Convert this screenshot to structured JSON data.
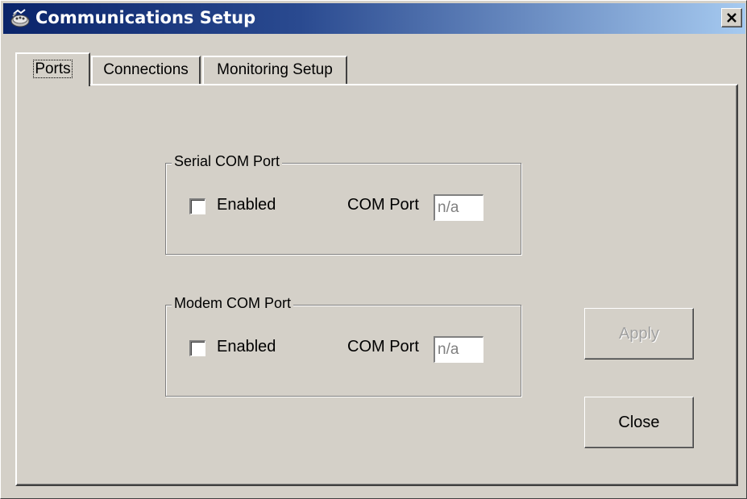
{
  "window": {
    "title": "Communications Setup",
    "icon": "network-settings-icon",
    "close_glyph": "close-icon"
  },
  "tabs": [
    {
      "label": "Ports",
      "active": true
    },
    {
      "label": "Connections",
      "active": false
    },
    {
      "label": "Monitoring Setup",
      "active": false
    }
  ],
  "serial": {
    "legend": "Serial COM Port",
    "enabled_label": "Enabled",
    "enabled": false,
    "port_label": "COM Port",
    "port_value": "n/a"
  },
  "modem": {
    "legend": "Modem COM Port",
    "enabled_label": "Enabled",
    "enabled": false,
    "port_label": "COM Port",
    "port_value": "n/a"
  },
  "buttons": {
    "apply": "Apply",
    "apply_enabled": false,
    "close": "Close"
  }
}
